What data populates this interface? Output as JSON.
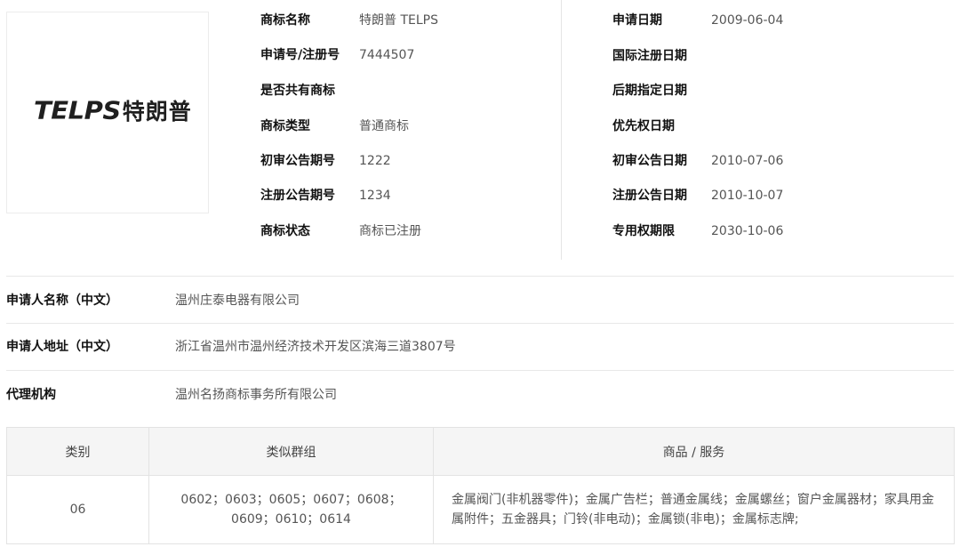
{
  "logo": {
    "latin": "TELPS",
    "chinese": "特朗普"
  },
  "left_info": [
    {
      "label": "商标名称",
      "value": "特朗普 TELPS"
    },
    {
      "label": "申请号/注册号",
      "value": "7444507"
    },
    {
      "label": "是否共有商标",
      "value": ""
    },
    {
      "label": "商标类型",
      "value": "普通商标"
    },
    {
      "label": "初审公告期号",
      "value": "1222"
    },
    {
      "label": "注册公告期号",
      "value": "1234"
    },
    {
      "label": "商标状态",
      "value": "商标已注册"
    }
  ],
  "right_info": [
    {
      "label": "申请日期",
      "value": "2009-06-04"
    },
    {
      "label": "国际注册日期",
      "value": ""
    },
    {
      "label": "后期指定日期",
      "value": ""
    },
    {
      "label": "优先权日期",
      "value": ""
    },
    {
      "label": "初审公告日期",
      "value": "2010-07-06"
    },
    {
      "label": "注册公告日期",
      "value": "2010-10-07"
    },
    {
      "label": "专用权期限",
      "value": "2030-10-06"
    }
  ],
  "details": [
    {
      "label": "申请人名称（中文）",
      "value": "温州庄泰电器有限公司"
    },
    {
      "label": "申请人地址（中文）",
      "value": "浙江省温州市温州经济技术开发区滨海三道3807号"
    },
    {
      "label": "代理机构",
      "value": "温州名扬商标事务所有限公司"
    }
  ],
  "table": {
    "headers": [
      "类别",
      "类似群组",
      "商品 / 服务"
    ],
    "rows": [
      {
        "category": "06",
        "groups": "0602；0603；0605；0607；0608；0609；0610；0614",
        "goods": "金属阀门(非机器零件)；金属广告栏；普通金属线；金属螺丝；窗户金属器材；家具用金属附件；五金器具；门铃(非电动)；金属锁(非电)；金属标志牌;"
      }
    ]
  }
}
